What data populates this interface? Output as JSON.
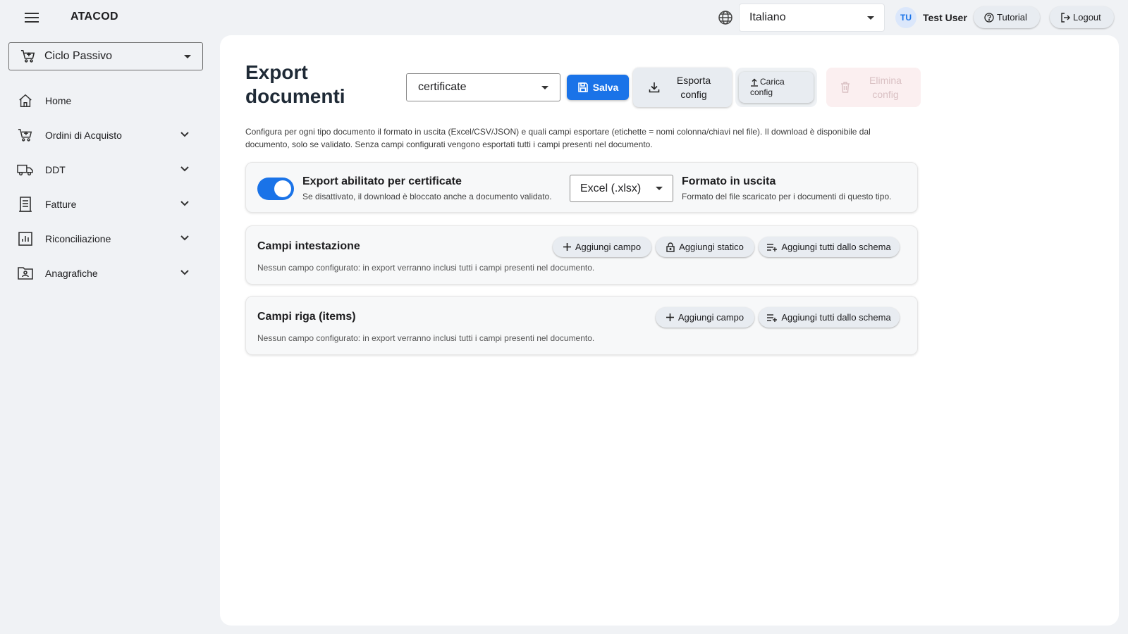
{
  "header": {
    "brand": "ATACOD",
    "language": "Italiano",
    "user_initials": "TU",
    "user_name": "Test User",
    "tutorial_label": "Tutorial",
    "logout_label": "Logout"
  },
  "sidebar": {
    "module": "Ciclo Passivo",
    "items": [
      {
        "label": "Home",
        "icon": "home-icon"
      },
      {
        "label": "Ordini di Acquisto",
        "icon": "cart-icon"
      },
      {
        "label": "DDT",
        "icon": "truck-icon"
      },
      {
        "label": "Fatture",
        "icon": "invoice-icon"
      },
      {
        "label": "Riconciliazione",
        "icon": "chart-icon"
      },
      {
        "label": "Anagrafiche",
        "icon": "contact-folder-icon"
      }
    ]
  },
  "main": {
    "title": "Export documenti",
    "doc_type": "certificate",
    "save_label": "Salva",
    "export_label": "Esporta config",
    "upload_label_1": "Carica",
    "upload_label_2": "config",
    "delete_label": "Elimina config",
    "description": "Configura per ogni tipo documento il formato in uscita (Excel/CSV/JSON) e quali campi esportare (etichette = nomi colonna/chiavi nel file). Il download è disponibile dal documento, solo se validato. Senza campi configurati vengono esportati tutti i campi presenti nel documento.",
    "toggle": {
      "enabled": true,
      "title": "Export abilitato per certificate",
      "subtitle": "Se disattivato, il download è bloccato anche a documento validato."
    },
    "format": {
      "value": "Excel (.xlsx)",
      "title": "Formato in uscita",
      "subtitle": "Formato del file scaricato per i documenti di questo tipo."
    },
    "header_fields": {
      "title": "Campi intestazione",
      "add_field": "Aggiungi campo",
      "add_static": "Aggiungi statico",
      "add_all": "Aggiungi tutti dallo schema",
      "empty": "Nessun campo configurato: in export verranno inclusi tutti i campi presenti nel documento."
    },
    "row_fields": {
      "title": "Campi riga (items)",
      "add_field": "Aggiungi campo",
      "add_all": "Aggiungi tutti dallo schema",
      "empty": "Nessun campo configurato: in export verranno inclusi tutti i campi presenti nel documento."
    }
  },
  "colors": {
    "accent": "#1a73e8",
    "background": "#f0f2f5",
    "card": "#ffffff"
  }
}
